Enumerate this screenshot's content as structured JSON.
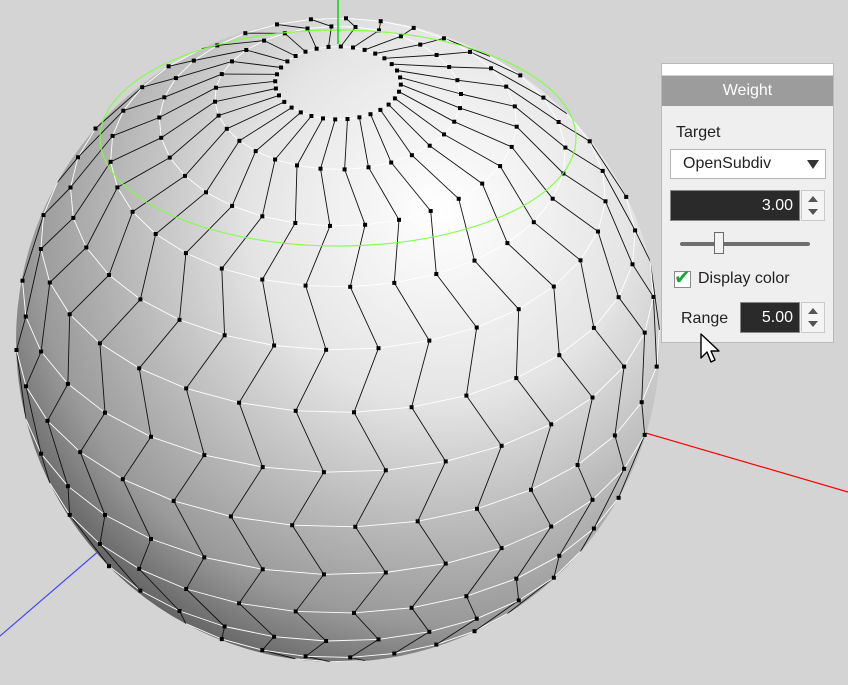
{
  "panel": {
    "title": "Weight",
    "target_label": "Target",
    "target_value": "OpenSubdiv",
    "weight_value": "3.00",
    "slider_fraction": 0.3,
    "display_color_label": "Display color",
    "display_color_checked": true,
    "range_label": "Range",
    "range_value": "5.00"
  },
  "colors": {
    "x_axis": "#ff0000",
    "y_axis": "#00ff00",
    "z_axis": "#4444ff",
    "selection_ring": "#7cff3c"
  },
  "icons": {
    "dropdown": "chevron-down-icon",
    "spinner_up": "arrow-up-icon",
    "spinner_down": "arrow-down-icon",
    "checkbox": "check-icon",
    "cursor": "mouse-pointer-icon"
  }
}
